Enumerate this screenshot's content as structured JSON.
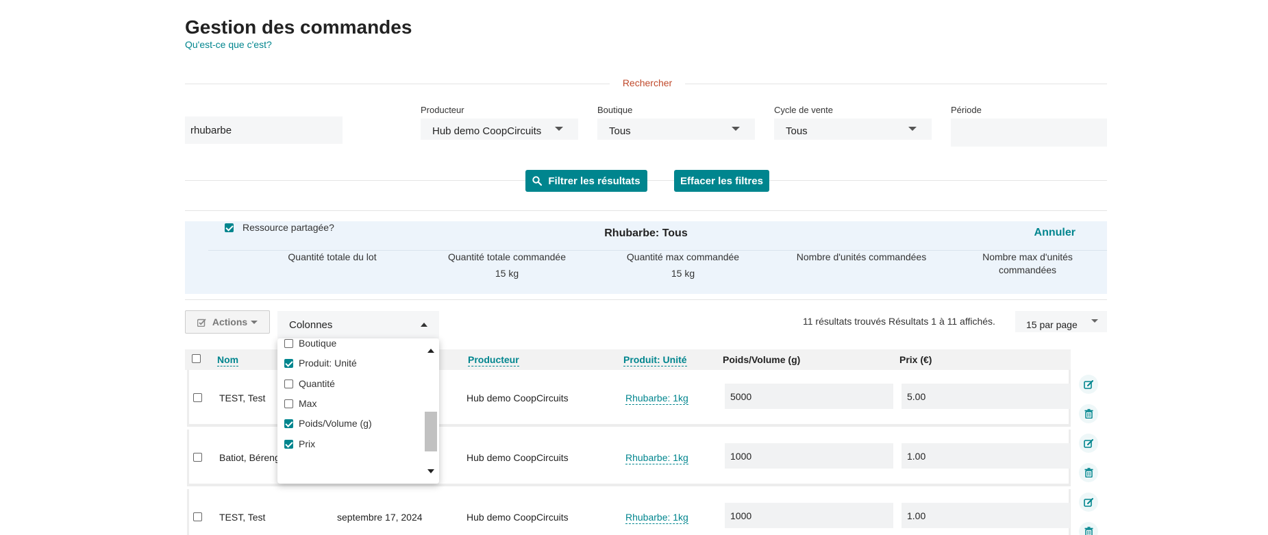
{
  "page": {
    "title": "Gestion des commandes",
    "help_link": "Qu'est-ce que c'est?"
  },
  "search": {
    "legend": "Rechercher",
    "query_value": "rhubarbe",
    "producer_label": "Producteur",
    "producer_value": "Hub demo CoopCircuits",
    "shop_label": "Boutique",
    "shop_value": "Tous",
    "cycle_label": "Cycle de vente",
    "cycle_value": "Tous",
    "period_label": "Période",
    "period_value": "",
    "filter_button": "Filtrer les résultats",
    "clear_button": "Effacer les filtres"
  },
  "bulk": {
    "shared_label": "Ressource partagée?",
    "shared_checked": true,
    "title": "Rhubarbe: Tous",
    "cancel": "Annuler",
    "columns": [
      {
        "label": "Quantité totale du lot",
        "value": ""
      },
      {
        "label": "Quantité totale commandée",
        "value": "15 kg"
      },
      {
        "label": "Quantité max commandée",
        "value": "15 kg"
      },
      {
        "label": "Nombre d'unités commandées",
        "value": ""
      },
      {
        "label": "Nombre max d'unités commandées",
        "value": ""
      }
    ]
  },
  "toolbar": {
    "actions_label": "Actions",
    "columns_label": "Colonnes",
    "results_text": "11 résultats trouvés Résultats 1 à 11 affichés.",
    "per_page": "15 par page"
  },
  "columns_menu": {
    "items": [
      {
        "label": "Boutique",
        "checked": false
      },
      {
        "label": "Produit: Unité",
        "checked": true
      },
      {
        "label": "Quantité",
        "checked": false
      },
      {
        "label": "Max",
        "checked": false
      },
      {
        "label": "Poids/Volume (g)",
        "checked": true
      },
      {
        "label": "Prix",
        "checked": true
      }
    ]
  },
  "table": {
    "headers": {
      "name": "Nom",
      "producer": "Producteur",
      "product_unit": "Produit: Unité",
      "weight": "Poids/Volume (g)",
      "price": "Prix (€)"
    },
    "rows": [
      {
        "name": "TEST, Test",
        "date": "",
        "producer": "Hub demo CoopCircuits",
        "product": "Rhubarbe: 1kg",
        "weight": "5000",
        "price": "5.00"
      },
      {
        "name": "Batiot, Bérenger",
        "date": "",
        "producer": "Hub demo CoopCircuits",
        "product": "Rhubarbe: 1kg",
        "weight": "1000",
        "price": "1.00"
      },
      {
        "name": "TEST, Test",
        "date": "septembre 17, 2024",
        "producer": "Hub demo CoopCircuits",
        "product": "Rhubarbe: 1kg",
        "weight": "1000",
        "price": "1.00"
      }
    ]
  },
  "colors": {
    "accent": "#00858e",
    "legend": "#c0492b",
    "panel": "#edf4fb"
  }
}
